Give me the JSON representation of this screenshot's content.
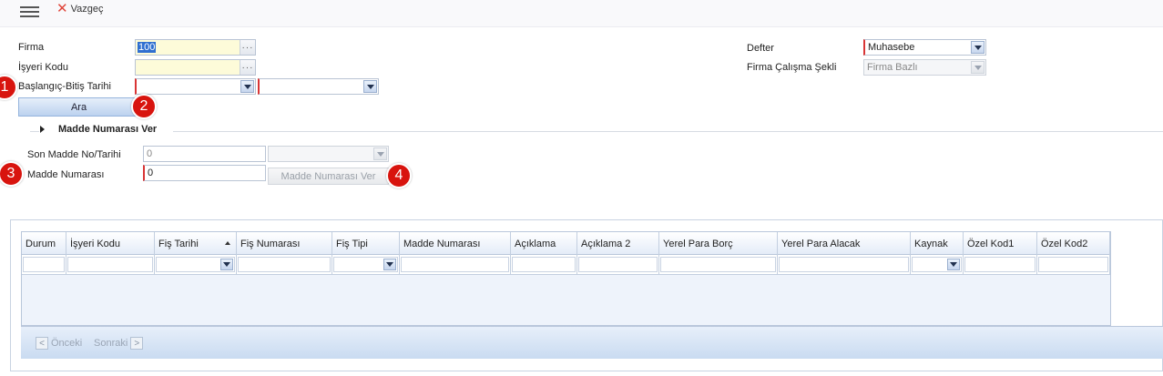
{
  "toolbar": {
    "cancel_label": "Vazgeç"
  },
  "form": {
    "firma_label": "Firma",
    "firma_value": "100",
    "isyeri_label": "İşyeri Kodu",
    "isyeri_value": "",
    "tarih_label": "Başlangıç-Bitiş Tarihi",
    "baslangic_value": "",
    "bitis_value": "",
    "defter_label": "Defter",
    "defter_value": "Muhasebe",
    "calisma_label": "Firma Çalışma Şekli",
    "calisma_value": "Firma Bazlı",
    "ara_label": "Ara"
  },
  "madde_section": {
    "title": "Madde Numarası Ver",
    "son_madde_label": "Son Madde No/Tarihi",
    "son_madde_value": "0",
    "son_madde_date": "",
    "madde_no_label": "Madde Numarası",
    "madde_no_value": "0",
    "ver_button_label": "Madde Numarası Ver"
  },
  "markers": [
    "1",
    "2",
    "3",
    "4"
  ],
  "grid": {
    "columns": [
      {
        "label": "Durum"
      },
      {
        "label": "İşyeri Kodu"
      },
      {
        "label": "Fiş Tarihi"
      },
      {
        "label": "Fiş Numarası"
      },
      {
        "label": "Fiş Tipi"
      },
      {
        "label": "Madde Numarası"
      },
      {
        "label": "Açıklama"
      },
      {
        "label": "Açıklama 2"
      },
      {
        "label": "Yerel Para Borç"
      },
      {
        "label": "Yerel Para Alacak"
      },
      {
        "label": "Kaynak"
      },
      {
        "label": "Özel Kod1"
      },
      {
        "label": "Özel Kod2"
      }
    ],
    "sorted_column": "Fiş Tarihi",
    "sort_direction": "ascending"
  },
  "pager": {
    "prev_label": "Önceki",
    "next_label": "Sonraki"
  }
}
